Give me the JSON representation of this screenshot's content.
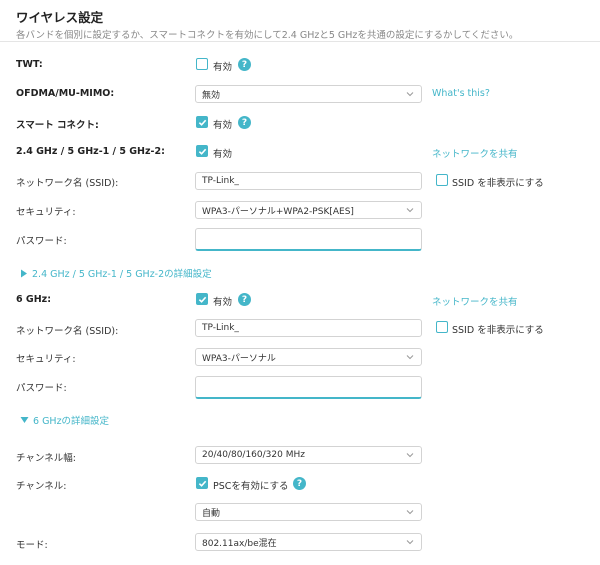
{
  "header": {
    "title": "ワイヤレス設定",
    "description": "各バンドを個別に設定するか、スマートコネクトを有効にして2.4 GHzと5 GHzを共通の設定にするかしてください。"
  },
  "twt": {
    "label": "TWT:",
    "checkbox_label": "有効",
    "checked": false
  },
  "ofdma": {
    "label": "OFDMA/MU-MIMO:",
    "value": "無効",
    "link": "What's this?"
  },
  "smart_connect": {
    "label": "スマート コネクト:",
    "checkbox_label": "有効",
    "checked": true
  },
  "band24_5": {
    "label": "2.4 GHz / 5 GHz-1 / 5 GHz-2:",
    "checkbox_label": "有効",
    "checked": true,
    "share_link": "ネットワークを共有",
    "ssid_label": "ネットワーク名 (SSID):",
    "ssid_value": "TP-Link_",
    "hide_ssid_label": "SSID を非表示にする",
    "security_label": "セキュリティ:",
    "security_value": "WPA3-パーソナル+WPA2-PSK[AES]",
    "password_label": "パスワード:",
    "password_value": "",
    "advanced_label": "2.4 GHz / 5 GHz-1 / 5 GHz-2の詳細設定"
  },
  "band6": {
    "label": "6 GHz:",
    "checkbox_label": "有効",
    "checked": true,
    "share_link": "ネットワークを共有",
    "ssid_label": "ネットワーク名 (SSID):",
    "ssid_value": "TP-Link_",
    "hide_ssid_label": "SSID を非表示にする",
    "security_label": "セキュリティ:",
    "security_value": "WPA3-パーソナル",
    "password_label": "パスワード:",
    "password_value": "",
    "advanced_label": "6 GHzの詳細設定",
    "channel_width_label": "チャンネル幅:",
    "channel_width_value": "20/40/80/160/320 MHz",
    "channel_label": "チャンネル:",
    "psc_label": "PSCを有効にする",
    "psc_checked": true,
    "channel_value": "自動",
    "mode_label": "モード:",
    "mode_value": "802.11ax/be混在"
  },
  "colors": {
    "accent": "#44b6c9",
    "border": "#d3d3d3",
    "muted": "#888888"
  }
}
